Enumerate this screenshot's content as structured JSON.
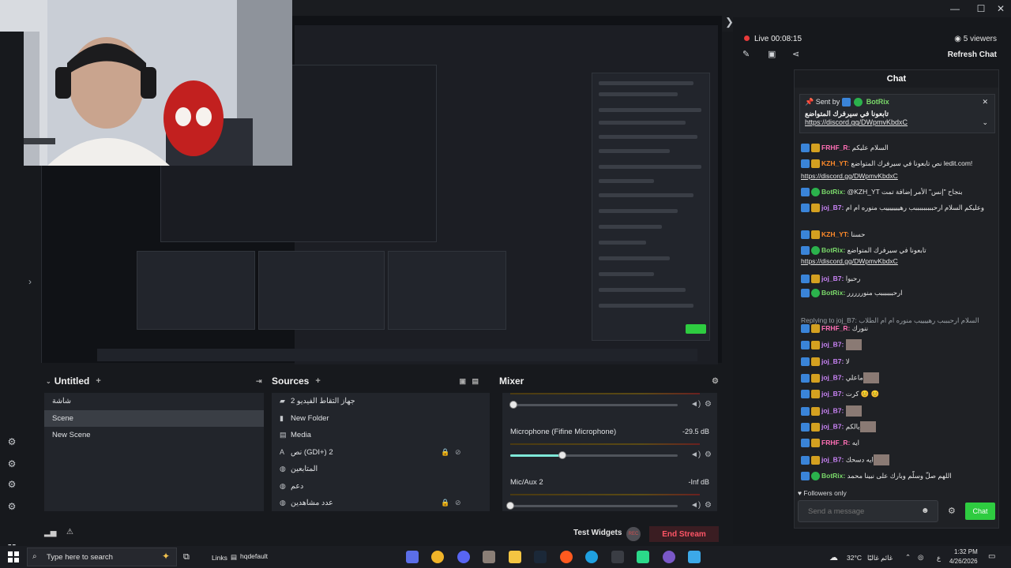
{
  "window": {
    "minimize": "—",
    "maximize": "☐",
    "close": "✕"
  },
  "rail": {
    "expand": "›"
  },
  "scene_dock": {
    "title": "Untitled",
    "add": "+",
    "items": [
      "شاشة",
      "Scene",
      "New Scene"
    ],
    "active_index": 1
  },
  "sources_dock": {
    "title": "Sources",
    "add": "+",
    "items": [
      {
        "label": "جهاز التقاط الفيديو 2",
        "icon": "video-icon"
      },
      {
        "label": "New Folder",
        "icon": "folder-icon"
      },
      {
        "label": "Media",
        "icon": "media-icon"
      },
      {
        "label": "نص (GDI+) 2",
        "icon": "text-icon"
      },
      {
        "label": "المتابعين",
        "icon": "globe-icon"
      },
      {
        "label": "دعم",
        "icon": "globe-icon"
      },
      {
        "label": "عدد مشاهدين",
        "icon": "globe-icon"
      }
    ]
  },
  "mixer": {
    "title": "Mixer",
    "channels": [
      {
        "name": "",
        "db": "",
        "level": 0.02
      },
      {
        "name": "Microphone (Fifine Microphone)",
        "db": "-29.5 dB",
        "level": 0.31
      },
      {
        "name": "Mic/Aux 2",
        "db": "-Inf dB",
        "level": 0.0
      }
    ]
  },
  "status": {
    "test_widgets": "Test Widgets",
    "rec": "REC",
    "end_stream": "End Stream"
  },
  "live": {
    "status": "Live 00:08:15",
    "viewers": "5 viewers",
    "refresh": "Refresh Chat"
  },
  "chat": {
    "title": "Chat",
    "pinned": {
      "by": "Sent by",
      "user": "BotRix",
      "text": "تابعونا في سيرفرك المتواضع",
      "link": "https://discord.gg/DWpmvKbdxC"
    },
    "messages": [
      {
        "user": "FRHF_R:",
        "color": "#ff6fb5",
        "text": "السلام عليكم"
      },
      {
        "user": "KZH_YT:",
        "color": "#ff8a2a",
        "text": "نص تابعونا في سيرفرك المتواضع ledit.com!"
      },
      {
        "user": "",
        "color": "#e6e6e6",
        "text": "https://discord.gg/DWpmvKbdxC"
      },
      {
        "user": "BotRix:",
        "color": "#7ad96a",
        "text": "@KZH_YT بنجاح \"إنس\" الأمر إضافة تمت"
      },
      {
        "user": "joj_B7:",
        "color": "#c983f5",
        "text": "وعليكم السلام ارحبببببببببب رهيييييييب منوره ام ام"
      },
      {
        "user": "KZH_YT:",
        "color": "#ff8a2a",
        "text": "حسنا"
      },
      {
        "user": "BotRix:",
        "color": "#7ad96a",
        "text": "تابعونا في سيرفرك المتواضع"
      },
      {
        "user": "",
        "color": "#e6e6e6",
        "text": "https://discord.gg/DWpmvKbdxC"
      },
      {
        "user": "joj_B7:",
        "color": "#c983f5",
        "text": "رحبوا"
      },
      {
        "user": "BotRix:",
        "color": "#7ad96a",
        "text": "ارحببببببب منوررررر"
      },
      {
        "user": "",
        "color": "#9aa0a6",
        "text": "Replying to joj_B7: السلام ارحبببب رهييييب منوره ام ام الطلاب"
      },
      {
        "user": "FRHF_R:",
        "color": "#ff6fb5",
        "text": "ننورك"
      },
      {
        "user": "joj_B7:",
        "color": "#c983f5",
        "text": ""
      },
      {
        "user": "joj_B7:",
        "color": "#c983f5",
        "text": "لا"
      },
      {
        "user": "joj_B7:",
        "color": "#c983f5",
        "text": "ماعلي"
      },
      {
        "user": "joj_B7:",
        "color": "#c983f5",
        "text": "كرت 😊 😊"
      },
      {
        "user": "joj_B7:",
        "color": "#c983f5",
        "text": ""
      },
      {
        "user": "joj_B7:",
        "color": "#c983f5",
        "text": "يالكم"
      },
      {
        "user": "FRHF_R:",
        "color": "#ff6fb5",
        "text": "ايه"
      },
      {
        "user": "joj_B7:",
        "color": "#c983f5",
        "text": "ايه دسحك"
      },
      {
        "user": "BotRix:",
        "color": "#7ad96a",
        "text": "اللهم صلّ وسلّم وبارك على نبينا محمد"
      }
    ],
    "followers_only": "Followers only",
    "input_placeholder": "Send a message",
    "send": "Chat"
  },
  "taskbar": {
    "search_placeholder": "Type here to search",
    "links": "Links",
    "folder": "hqdefault",
    "weather": "32°C",
    "weather_text": "غائم غالبًا",
    "lang": "ع",
    "time": "1:32 PM",
    "date": "4/26/2026"
  },
  "colors": {
    "accent_green": "#2ecc40",
    "live_red": "#e83a3a",
    "end_stream": "#ff5566"
  }
}
